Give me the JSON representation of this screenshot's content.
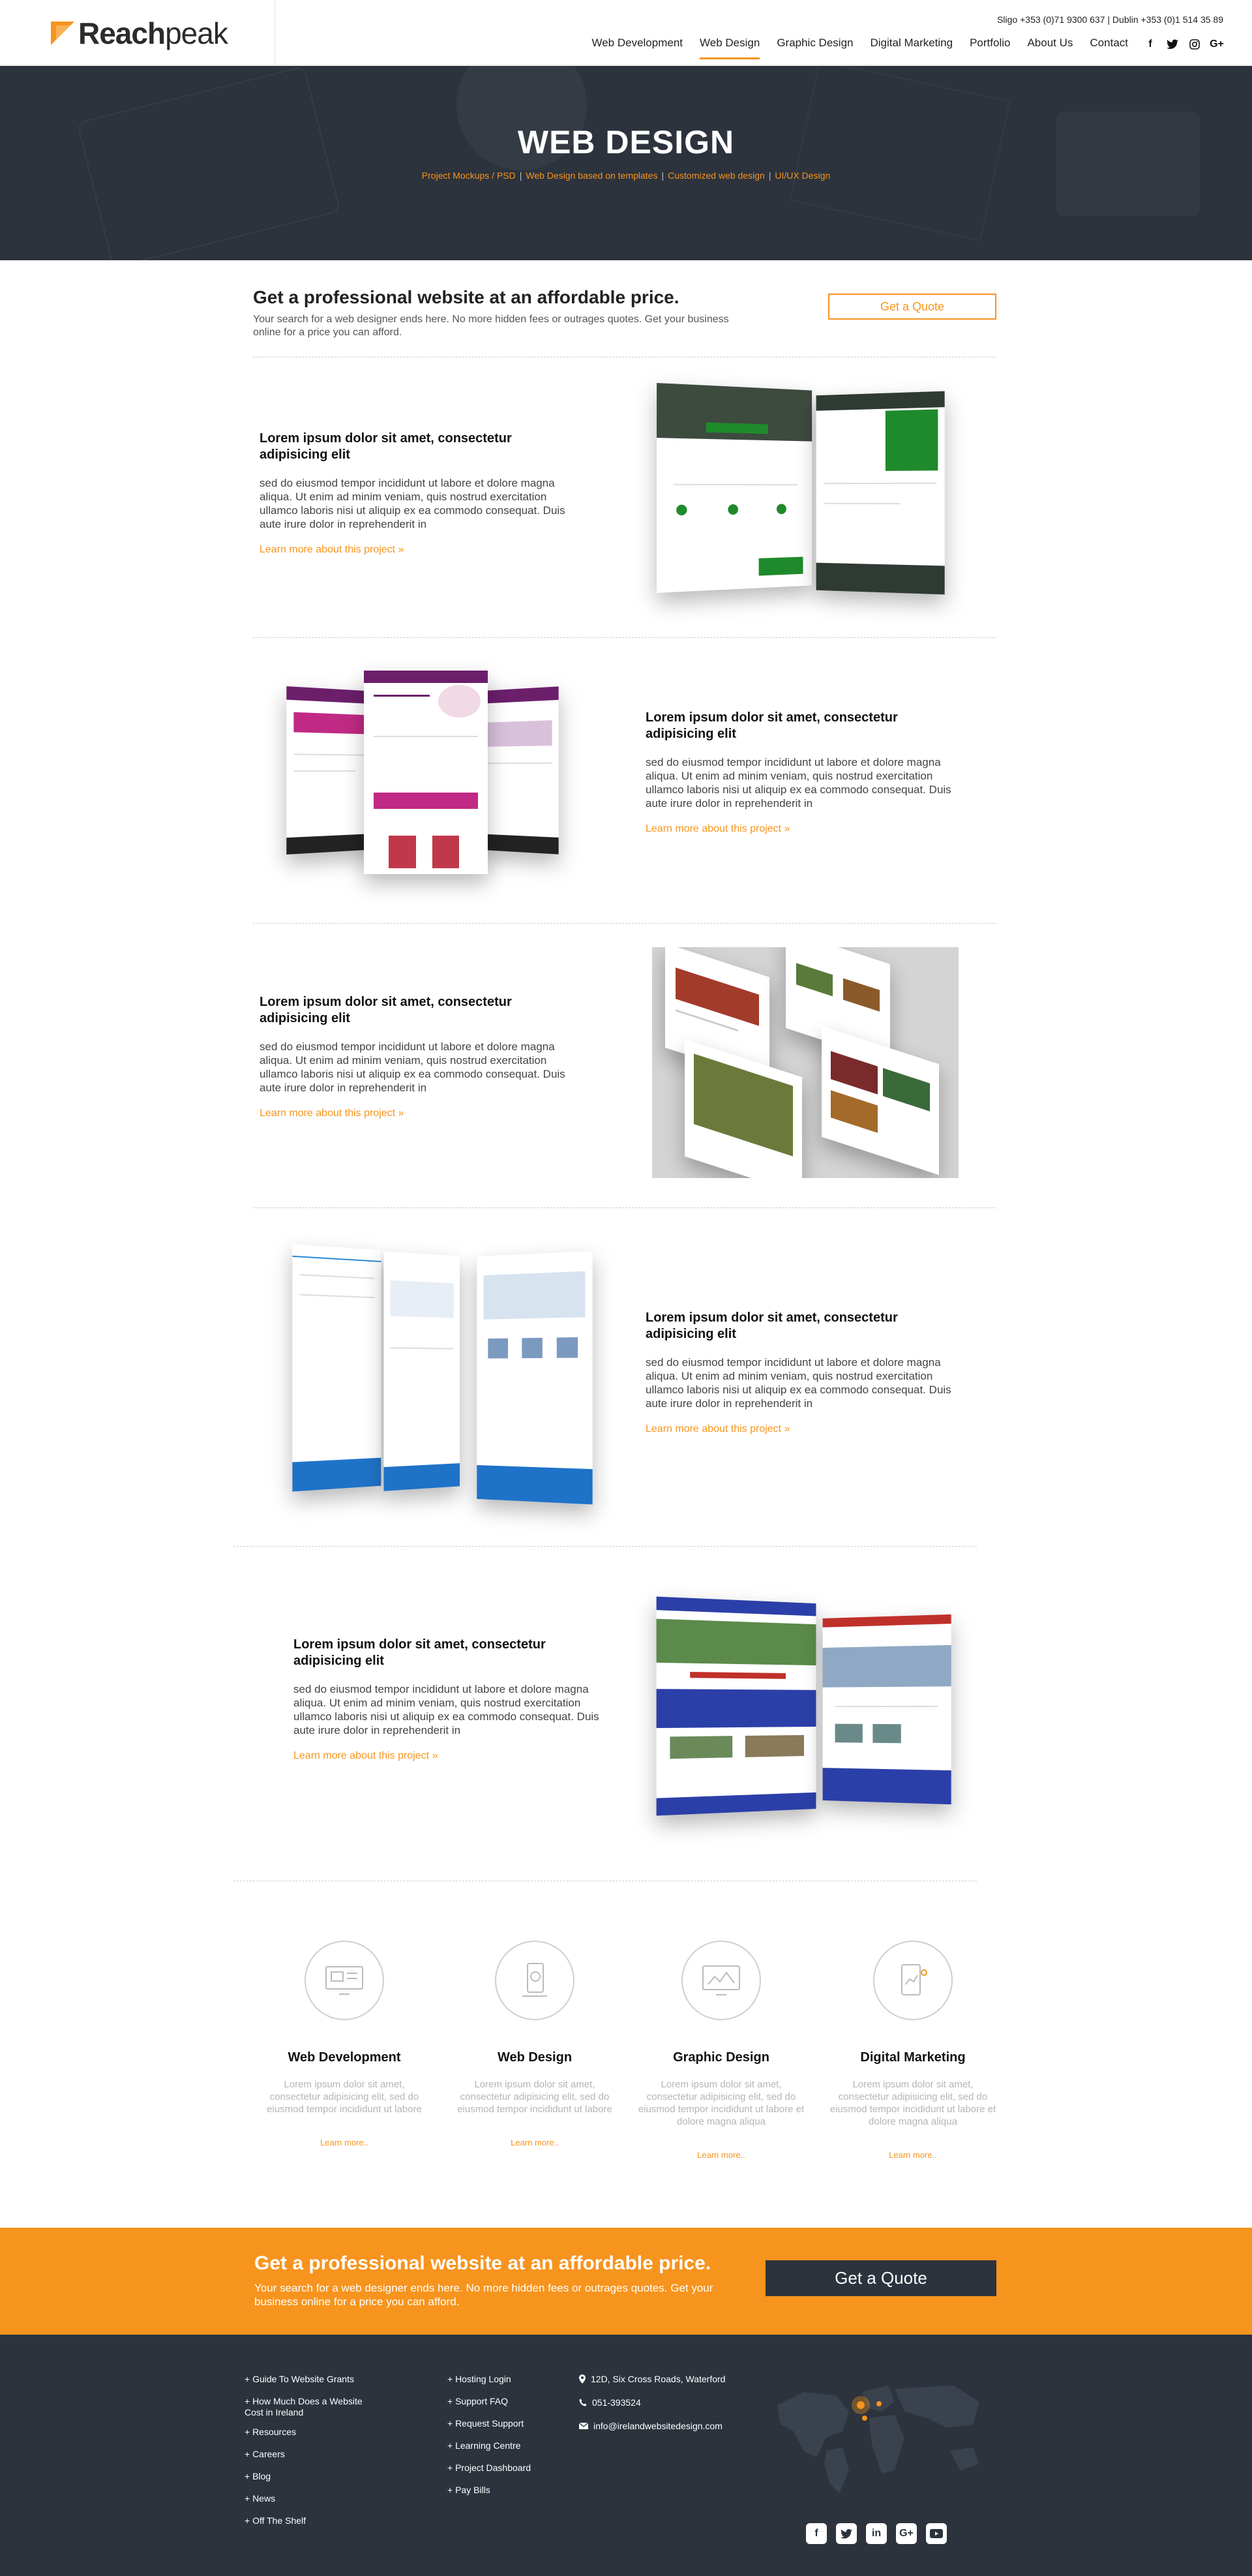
{
  "header": {
    "logo_text_bold": "Reach",
    "logo_text_light": "peak",
    "contact_line": "Sligo +353 (0)71 9300 637 | Dublin +353 (0)1 514 35 89",
    "nav": [
      {
        "label": "Web Development",
        "active": false
      },
      {
        "label": "Web Design",
        "active": true
      },
      {
        "label": "Graphic Design",
        "active": false
      },
      {
        "label": "Digital Marketing",
        "active": false
      },
      {
        "label": "Portfolio",
        "active": false
      },
      {
        "label": "About Us",
        "active": false
      },
      {
        "label": "Contact",
        "active": false
      }
    ],
    "social_icons": [
      "facebook-icon",
      "twitter-icon",
      "instagram-icon",
      "google-plus-icon"
    ]
  },
  "hero": {
    "title": "WEB DESIGN",
    "crumbs": [
      "Project Mockups / PSD",
      "Web Design based on templates",
      "Customized web design",
      "UI/UX Design"
    ]
  },
  "intro": {
    "heading": "Get a professional website at an affordable price.",
    "text": "Your search for a web designer ends here. No more hidden fees or outrages quotes. Get your business online for a price you can afford.",
    "button": "Get a Quote"
  },
  "projects": [
    {
      "title": "Lorem ipsum dolor sit amet, consectetur adipisicing elit",
      "text": "sed do eiusmod tempor incididunt ut labore et dolore magna aliqua. Ut enim ad minim veniam, quis nostrud exercitation ullamco laboris nisi ut aliquip ex ea commodo consequat. Duis aute irure dolor in reprehenderit in",
      "link": "Learn more about this project »"
    },
    {
      "title": "Lorem ipsum dolor sit amet, consectetur adipisicing elit",
      "text": "sed do eiusmod tempor incididunt ut labore et dolore magna aliqua. Ut enim ad minim veniam, quis nostrud exercitation ullamco laboris nisi ut aliquip ex ea commodo consequat. Duis aute irure dolor in reprehenderit in",
      "link": "Learn more about this project »"
    },
    {
      "title": "Lorem ipsum dolor sit amet, consectetur adipisicing elit",
      "text": "sed do eiusmod tempor incididunt ut labore et dolore magna aliqua. Ut enim ad minim veniam, quis nostrud exercitation ullamco laboris nisi ut aliquip ex ea commodo consequat. Duis aute irure dolor in reprehenderit in",
      "link": "Learn more about this project »"
    },
    {
      "title": "Lorem ipsum dolor sit amet, consectetur adipisicing elit",
      "text": "sed do eiusmod tempor incididunt ut labore et dolore magna aliqua. Ut enim ad minim veniam, quis nostrud exercitation ullamco laboris nisi ut aliquip ex ea commodo consequat. Duis aute irure dolor in reprehenderit in",
      "link": "Learn more about this project »"
    },
    {
      "title": "Lorem ipsum dolor sit amet, consectetur adipisicing elit",
      "text": "sed do eiusmod tempor incididunt ut labore et dolore magna aliqua. Ut enim ad minim veniam, quis nostrud exercitation ullamco laboris nisi ut aliquip ex ea commodo consequat. Duis aute irure dolor in reprehenderit in",
      "link": "Learn more about this project »"
    }
  ],
  "services": [
    {
      "title": "Web Development",
      "text": "Lorem ipsum dolor sit amet, consectetur adipisicing elit, sed do eiusmod tempor incididunt ut labore",
      "link": "Learn more..",
      "icon": "monitor-icon"
    },
    {
      "title": "Web Design",
      "text": "Lorem ipsum dolor sit amet, consectetur adipisicing elit, sed do eiusmod tempor incididunt ut labore",
      "link": "Learn more..",
      "icon": "mobile-design-icon"
    },
    {
      "title": "Graphic Design",
      "text": "Lorem ipsum dolor sit amet, consectetur adipisicing elit, sed do eiusmod tempor incididunt ut labore et dolore magna aliqua",
      "link": "Learn more..",
      "icon": "graphic-monitor-icon"
    },
    {
      "title": "Digital Marketing",
      "text": "Lorem ipsum dolor sit amet, consectetur adipisicing elit, sed do eiusmod tempor incididunt ut labore et dolore magna aliqua",
      "link": "Learn more..",
      "icon": "marketing-tablet-icon"
    }
  ],
  "cta": {
    "heading": "Get a professional website at an affordable price.",
    "text": "Your search for a web designer ends here. No more hidden fees or outrages quotes. Get your business online for a price you can afford.",
    "button": "Get a Quote"
  },
  "footer": {
    "col1": [
      "+ Guide To Website Grants",
      "+ How Much Does a Website Cost in Ireland",
      "+ Resources",
      "+ Careers",
      "+ Blog",
      "+ News",
      "+ Off The Shelf"
    ],
    "col2": [
      "+ Hosting Login",
      "+ Support FAQ",
      "+ Request Support",
      "+ Learning Centre",
      "+ Project Dashboard",
      "+ Pay Bills"
    ],
    "address": "12D, Six Cross Roads, Waterford",
    "phone": "051-393524",
    "email": "info@irelandwebsitedesign.com",
    "social_icons": [
      "facebook-icon",
      "twitter-icon",
      "linkedin-icon",
      "google-plus-icon",
      "youtube-icon"
    ]
  },
  "colors": {
    "accent": "#f7941d",
    "dark": "#2c333d"
  }
}
